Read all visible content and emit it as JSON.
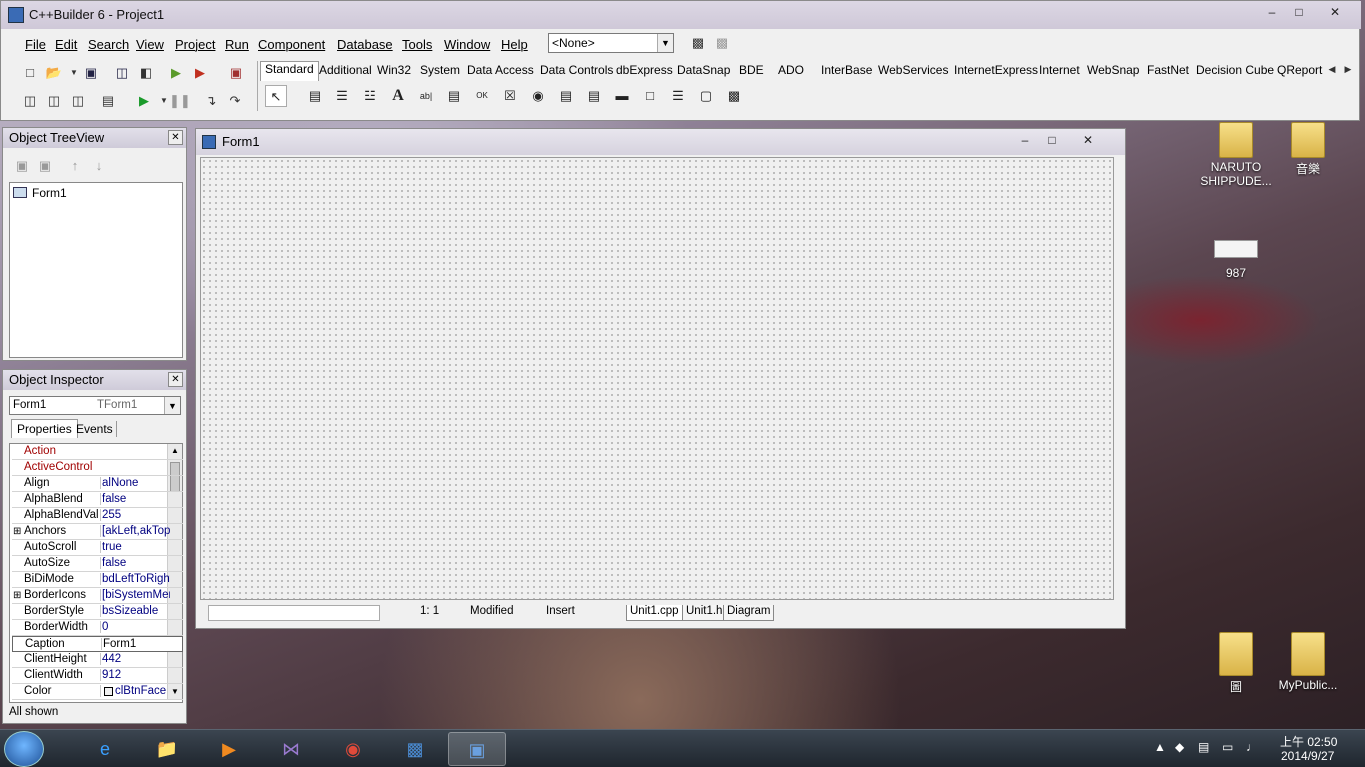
{
  "app": {
    "title": "C++Builder 6 - Project1"
  },
  "menu": [
    "File",
    "Edit",
    "Search",
    "View",
    "Project",
    "Run",
    "Component",
    "Database",
    "Tools",
    "Window",
    "Help"
  ],
  "config_combo": "<None>",
  "palette_tabs": [
    "Standard",
    "Additional",
    "Win32",
    "System",
    "Data Access",
    "Data Controls",
    "dbExpress",
    "DataSnap",
    "BDE",
    "ADO",
    "InterBase",
    "WebServices",
    "InternetExpress",
    "Internet",
    "WebSnap",
    "FastNet",
    "Decision Cube",
    "QReport"
  ],
  "treeview": {
    "title": "Object TreeView",
    "node": "Form1"
  },
  "inspector": {
    "title": "Object Inspector",
    "object_name": "Form1",
    "object_type": "TForm1",
    "tabs": [
      "Properties",
      "Events"
    ],
    "props": [
      {
        "name": "Action",
        "value": "",
        "red": true
      },
      {
        "name": "ActiveControl",
        "value": "",
        "red": true
      },
      {
        "name": "Align",
        "value": "alNone"
      },
      {
        "name": "AlphaBlend",
        "value": "false"
      },
      {
        "name": "AlphaBlendValu",
        "value": "255"
      },
      {
        "name": "Anchors",
        "value": "[akLeft,akTop",
        "expand": true
      },
      {
        "name": "AutoScroll",
        "value": "true"
      },
      {
        "name": "AutoSize",
        "value": "false"
      },
      {
        "name": "BiDiMode",
        "value": "bdLeftToRight"
      },
      {
        "name": "BorderIcons",
        "value": "[biSystemMen",
        "expand": true
      },
      {
        "name": "BorderStyle",
        "value": "bsSizeable"
      },
      {
        "name": "BorderWidth",
        "value": "0"
      },
      {
        "name": "Caption",
        "value": "Form1",
        "selected": true
      },
      {
        "name": "ClientHeight",
        "value": "442"
      },
      {
        "name": "ClientWidth",
        "value": "912"
      },
      {
        "name": "Color",
        "value": "clBtnFace"
      }
    ],
    "status": "All shown"
  },
  "form": {
    "title": "Form1",
    "status_pos": "1:  1",
    "status_modified": "Modified",
    "status_mode": "Insert",
    "tabs": [
      "Unit1.cpp",
      "Unit1.h",
      "Diagram"
    ]
  },
  "desktop_icons": [
    {
      "label": "NARUTO SHIPPUDE..."
    },
    {
      "label": "音樂"
    },
    {
      "label": "987"
    },
    {
      "label": "圖"
    },
    {
      "label": "MyPublic..."
    }
  ],
  "taskbar": {
    "time": "上午 02:50",
    "date": "2014/9/27"
  }
}
